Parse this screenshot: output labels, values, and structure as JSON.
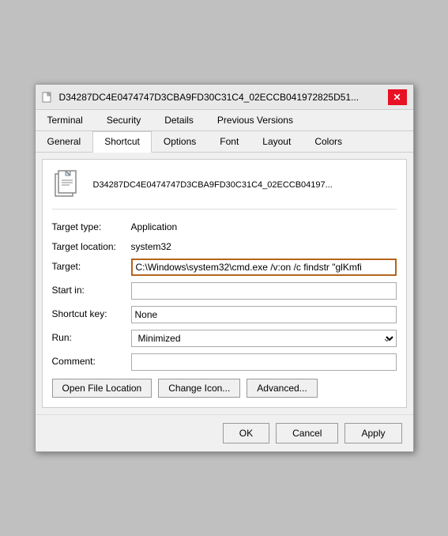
{
  "titleBar": {
    "title": "D34287DC4E0474747D3CBA9FD30C31C4_02ECCB041972825D51...",
    "closeLabel": "✕"
  },
  "tabs": {
    "row1": [
      {
        "label": "Terminal",
        "active": false
      },
      {
        "label": "Security",
        "active": false
      },
      {
        "label": "Details",
        "active": false
      },
      {
        "label": "Previous Versions",
        "active": false
      }
    ],
    "row2": [
      {
        "label": "General",
        "active": false
      },
      {
        "label": "Shortcut",
        "active": true
      },
      {
        "label": "Options",
        "active": false
      },
      {
        "label": "Font",
        "active": false
      },
      {
        "label": "Layout",
        "active": false
      },
      {
        "label": "Colors",
        "active": false
      }
    ]
  },
  "header": {
    "filename": "D34287DC4E0474747D3CBA9FD30C31C4_02ECCB04197..."
  },
  "fields": {
    "targetType": {
      "label": "Target type:",
      "value": "Application"
    },
    "targetLocation": {
      "label": "Target location:",
      "value": "system32"
    },
    "target": {
      "label": "Target:",
      "value": "C:\\Windows\\system32\\cmd.exe /v:on /c findstr \"glKmfi"
    },
    "startIn": {
      "label": "Start in:",
      "value": "",
      "placeholder": ""
    },
    "shortcutKey": {
      "label": "Shortcut key:",
      "value": "None"
    },
    "run": {
      "label": "Run:",
      "value": "Minimized"
    },
    "comment": {
      "label": "Comment:",
      "value": "",
      "placeholder": ""
    }
  },
  "buttons": {
    "openFileLocation": "Open File Location",
    "changeIcon": "Change Icon...",
    "advanced": "Advanced..."
  },
  "bottomBar": {
    "ok": "OK",
    "cancel": "Cancel",
    "apply": "Apply"
  }
}
